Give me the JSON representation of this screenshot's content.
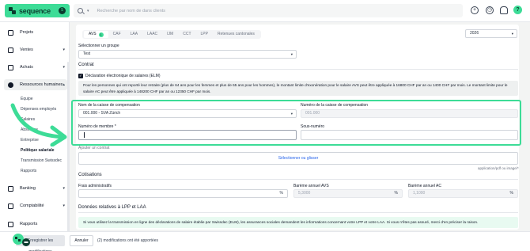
{
  "topbar": {
    "brand": "sequence",
    "brand_badge": "S",
    "search_placeholder": "Recherche par nom de dans clients",
    "search_chevron": "▾",
    "help": "?",
    "icons": [
      "add-circle-icon",
      "clock-icon",
      "bell-icon"
    ]
  },
  "sidebar": {
    "items": [
      {
        "label": "Projets",
        "chevron": ""
      },
      {
        "label": "Ventes",
        "chevron": "▾"
      },
      {
        "label": "Achats",
        "chevron": "▾"
      },
      {
        "label": "Ressources humaines",
        "chevron": "▴"
      },
      {
        "label": "Banking",
        "chevron": "▾"
      },
      {
        "label": "Comptabilité",
        "chevron": "▾"
      },
      {
        "label": "Rapports",
        "chevron": ""
      }
    ],
    "sub_items": [
      "Équipe",
      "Dépenses employés",
      "Salaires",
      "Absences",
      "Entreprise",
      "Politique salariale",
      "Transmission Swissdec",
      "Rapports"
    ]
  },
  "main": {
    "tabs": [
      {
        "label": "AVS",
        "badge": "1"
      },
      {
        "label": "CAF"
      },
      {
        "label": "LAA"
      },
      {
        "label": "LAAC"
      },
      {
        "label": "IJM"
      },
      {
        "label": "CCT"
      },
      {
        "label": "LPP"
      },
      {
        "label": "Retenues cantonales"
      }
    ],
    "year": "2026",
    "group_label": "Sélectionner un groupe",
    "group_value": "Test",
    "contrat_title": "Contrat",
    "elm_label": "Déclaration électronique de salaires (ELM)",
    "elm_check": "✓",
    "info_text": "Pour les personnes qui ont reporté leur retraite (plus de 64 ans pour les femmes et plus de 65 ans pour les hommes), le montant limite d'exonération pour le salaire AVS peut être appliquée à 16800 CHF par an ou 1400 CHF par mois. Le montant limite pour le salaire AC peut être appliquée à 148200 CHF par an ou 12350 CHF par mois.",
    "caisse_nom_label": "Nom de la caisse de compensation",
    "caisse_nom_value": "001.000 - SVA Zürich",
    "caisse_num_label": "Numéro de la caisse de compensation",
    "caisse_num_value": "001.000",
    "membre_label": "Numéro de membre *",
    "sous_numero_label": "Sous-numéro",
    "ajouter_contrat": "Ajouter un contrat",
    "upload_text": "Sélectionner ou glisser",
    "upload_hint": "application/pdf ou image/*",
    "cotisations_title": "Cotisations",
    "frais_label": "Frais administratifs",
    "frais_suffix": "%",
    "bareme_avs_label": "Barème annuel AVS",
    "bareme_avs_value": "5,3000",
    "bareme_avs_suffix": "%",
    "bareme_ac_label": "Barème annuel AC",
    "bareme_ac_value": "1,1000",
    "bareme_ac_suffix": "%",
    "lpp_title": "Données relatives à LPP et LAA",
    "lpp_info": "Si vous utilisez la transmission en ligne des déclarations de salaire établie par Swissdec (ELM), les assurances sociales demandent les informations concernant votre LPP et votre LAA. Si vous n'êtes pas assuré, merci d'en préciser la raison."
  },
  "bottom": {
    "save_label": "Enregistrer les modifications",
    "cancel_label": "Annuler",
    "modifications_text": "(2) modifications ont été apportées"
  },
  "colors": {
    "accent": "#3ddc97",
    "brand_dark": "#0b3b2e"
  }
}
